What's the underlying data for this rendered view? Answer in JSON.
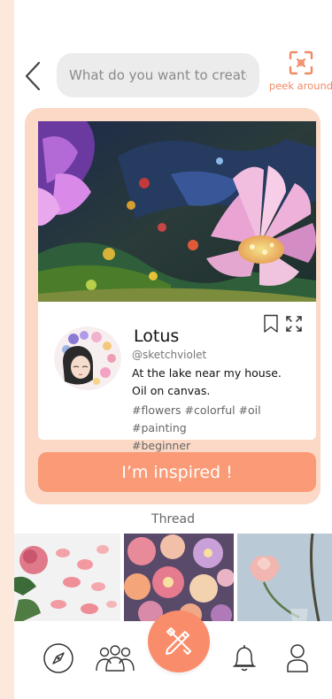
{
  "colors": {
    "accent": "#fb9a76",
    "card_bg": "#fbd9c6",
    "page_bg": "#fde9dc",
    "peek": "#f08a66"
  },
  "header": {
    "back_icon": "chevron-left-icon",
    "search_placeholder": "What do you want to create ?",
    "peek_label": "peek around",
    "peek_icon": "scan-icon"
  },
  "post": {
    "title": "Lotus",
    "handle": "@sketchviolet",
    "description_lines": [
      "At the lake near my house.",
      "Oil on canvas."
    ],
    "tags_line1": "#flowers #colorful #oil #painting",
    "tags_line2": "#beginner",
    "bookmark_icon": "bookmark-icon",
    "expand_icon": "expand-icon"
  },
  "cta": {
    "label": "I’m inspired !"
  },
  "thread": {
    "label": "Thread",
    "items": [
      "rose-petals",
      "flower-collage",
      "pink-tulip"
    ]
  },
  "nav": {
    "items": [
      "compass-icon",
      "community-icon",
      "create-icon",
      "bell-icon",
      "profile-icon"
    ]
  }
}
